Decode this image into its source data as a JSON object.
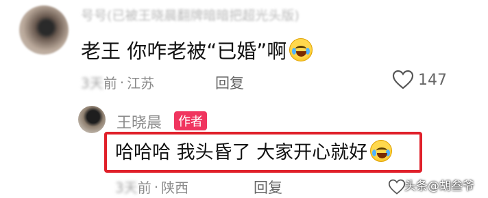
{
  "comment_main": {
    "username": "号号(已被王晓晨翻牌暗暗把超光头版)",
    "text": "老王 你咋老被“已婚”啊",
    "time_prefix": "3天",
    "time_suffix": "前",
    "dot": "·",
    "location": "江苏",
    "reply_label": "回复",
    "like_count": "147"
  },
  "reply": {
    "author_name": "王晓晨",
    "author_badge": "作者",
    "text": "哈哈哈 我头昏了 大家开心就好",
    "time_prefix": "3天",
    "time_suffix": "前",
    "dot": "·",
    "location": "陕西",
    "reply_label": "回复"
  },
  "watermark": "头条@胡叁爷",
  "colors": {
    "highlight_border": "#e0202a",
    "author_badge_bg": "#f0355f"
  }
}
